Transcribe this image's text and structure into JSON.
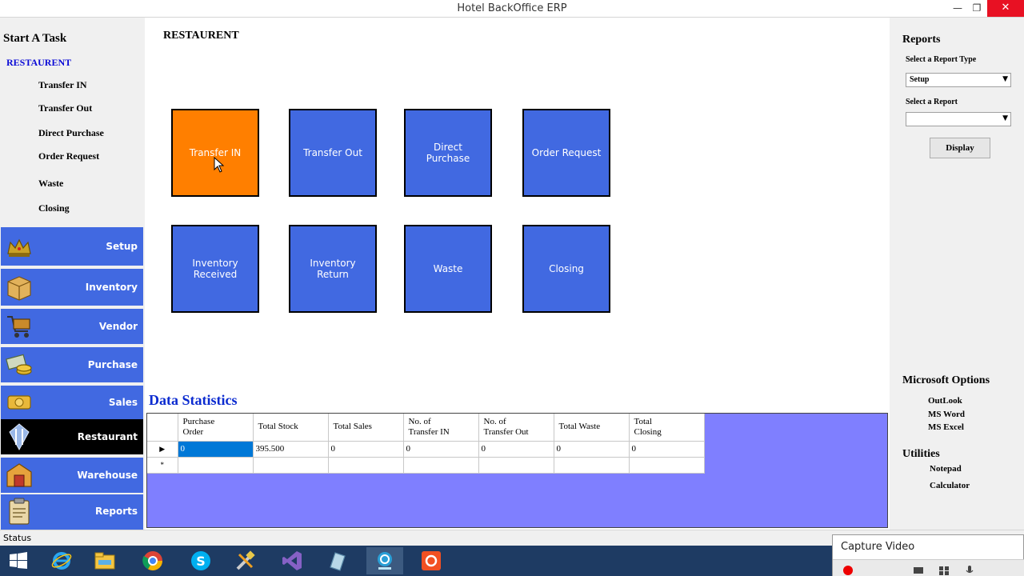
{
  "window": {
    "title": "Hotel BackOffice ERP",
    "minimize_glyph": "—",
    "restore_glyph": "❐",
    "close_glyph": "✕"
  },
  "task_panel": {
    "heading": "Start A Task",
    "section": "RESTAURENT",
    "tasks": [
      "Transfer IN",
      "Transfer Out",
      "Direct Purchase",
      "Order Request",
      "Waste",
      "Closing"
    ]
  },
  "nav": {
    "items": [
      {
        "label": "Setup",
        "icon": "crown-icon"
      },
      {
        "label": "Inventory",
        "icon": "box-icon"
      },
      {
        "label": "Vendor",
        "icon": "cart-icon"
      },
      {
        "label": "Purchase",
        "icon": "money-icon"
      },
      {
        "label": "Sales",
        "icon": "coins-icon"
      },
      {
        "label": "Restaurant",
        "icon": "cutlery-icon",
        "active": true
      },
      {
        "label": "Warehouse",
        "icon": "warehouse-icon"
      },
      {
        "label": "Reports",
        "icon": "clipboard-icon"
      }
    ]
  },
  "main": {
    "title": "RESTAURENT",
    "tiles": [
      {
        "label": "Transfer IN",
        "active": true
      },
      {
        "label": "Transfer Out"
      },
      {
        "label": "Direct\nPurchase"
      },
      {
        "label": "Order Request"
      },
      {
        "label": "Inventory\nReceived"
      },
      {
        "label": "Inventory\nReturn"
      },
      {
        "label": "Waste"
      },
      {
        "label": "Closing"
      }
    ],
    "stats_title": "Data Statistics",
    "grid": {
      "headers": [
        "Purchase\nOrder",
        "Total Stock",
        "Total Sales",
        "No. of\nTransfer IN",
        "No. of\nTransfer Out",
        "Total Waste",
        "Total\nClosing"
      ],
      "rows": [
        [
          "0",
          "395.500",
          "0",
          "0",
          "0",
          "0",
          "0"
        ]
      ],
      "current_row_marker": "▶",
      "new_row_marker": "*"
    }
  },
  "reports": {
    "title": "Reports",
    "type_label": "Select a  Report Type",
    "type_value": "Setup",
    "report_label": "Select a Report",
    "report_value": "",
    "display_label": "Display",
    "caret": "▼"
  },
  "microsoft_options": {
    "title": "Microsoft Options",
    "items": [
      "OutLook",
      "MS Word",
      "MS Excel"
    ]
  },
  "utilities": {
    "title": "Utilities",
    "items": [
      "Notepad",
      "Calculator"
    ]
  },
  "status": {
    "text": "Status"
  },
  "taskbar": {
    "apps": [
      "windows-start-icon",
      "internet-explorer-icon",
      "file-explorer-icon",
      "chrome-icon",
      "skype-icon",
      "tools-icon",
      "visual-studio-icon",
      "sql-icon",
      "capture-studio-icon",
      "recorder-icon"
    ]
  },
  "capture_window": {
    "title": "Capture Video"
  },
  "colors": {
    "tile_blue": "#4169e1",
    "tile_active": "#ff7f00",
    "grid_bg": "#7f7fff",
    "taskbar": "#1e3b63"
  }
}
